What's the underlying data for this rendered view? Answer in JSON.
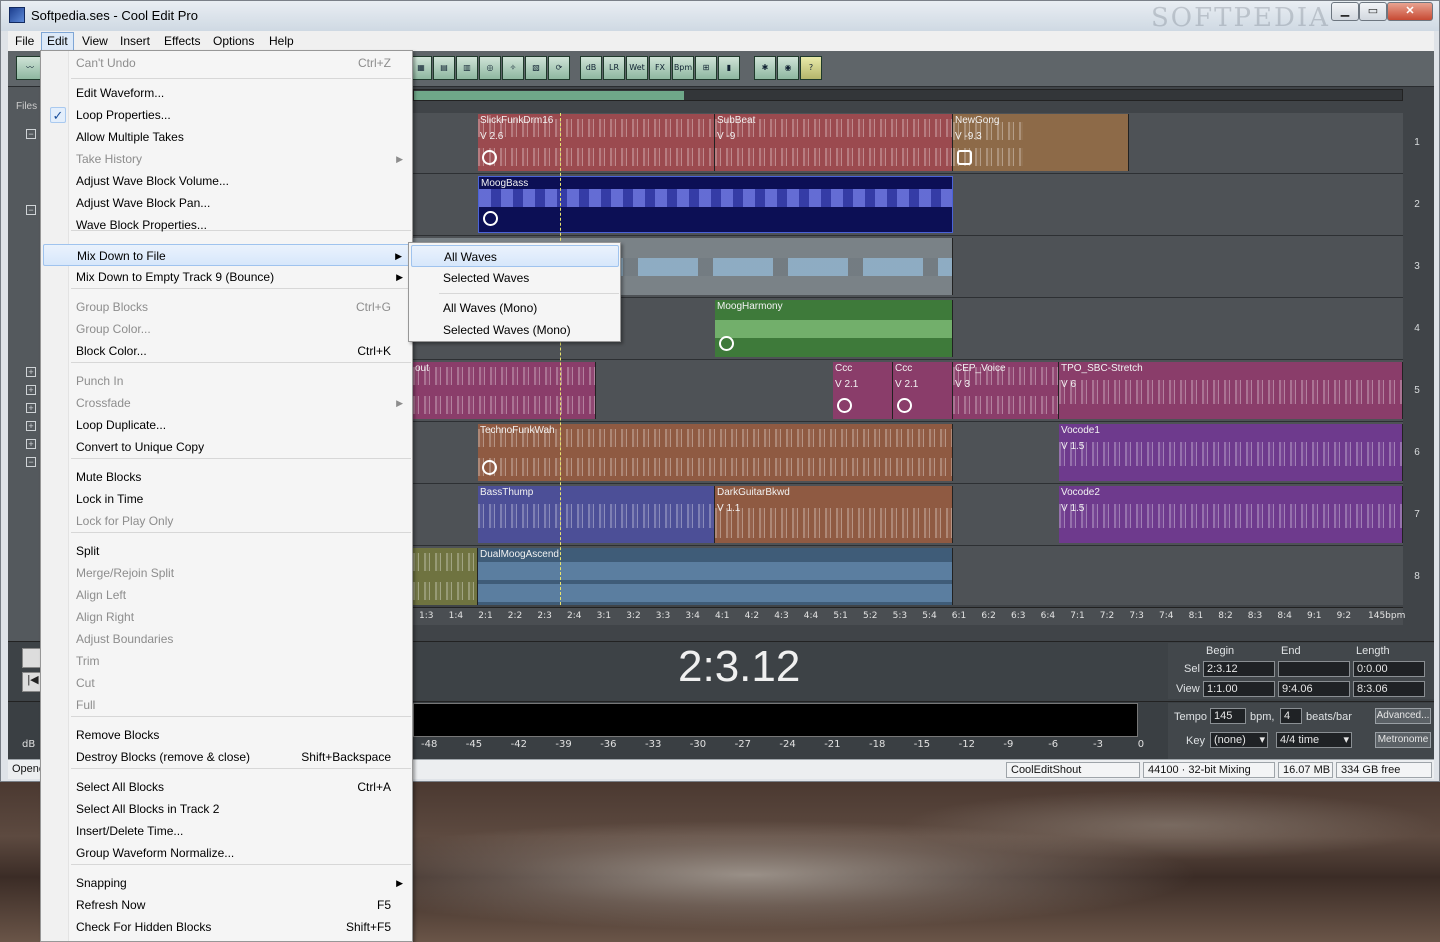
{
  "window": {
    "title": "Softpedia.ses - Cool Edit Pro",
    "watermark": "SOFTPEDIA"
  },
  "menubar": [
    "File",
    "Edit",
    "View",
    "Insert",
    "Effects",
    "Options",
    "Help"
  ],
  "edit_menu": [
    {
      "label": "Can't Undo",
      "shortcut": "Ctrl+Z",
      "disabled": true
    },
    {
      "label": "Edit Waveform...",
      "shortcut": ""
    },
    {
      "label": "Loop Properties...",
      "shortcut": "",
      "checked": true
    },
    {
      "label": "Allow Multiple Takes",
      "shortcut": ""
    },
    {
      "label": "Take History",
      "shortcut": "",
      "disabled": true,
      "submenu": true
    },
    {
      "label": "Adjust Wave Block Volume...",
      "shortcut": ""
    },
    {
      "label": "Adjust Wave Block Pan...",
      "shortcut": ""
    },
    {
      "label": "Wave Block Properties...",
      "shortcut": ""
    },
    {
      "label": "Mix Down to File",
      "shortcut": "",
      "submenu": true,
      "highlighted": true
    },
    {
      "label": "Mix Down to Empty Track 9 (Bounce)",
      "shortcut": "",
      "submenu": true
    },
    {
      "label": "Group Blocks",
      "shortcut": "Ctrl+G",
      "disabled": true
    },
    {
      "label": "Group Color...",
      "shortcut": "",
      "disabled": true
    },
    {
      "label": "Block Color...",
      "shortcut": "Ctrl+K"
    },
    {
      "label": "Punch In",
      "shortcut": "",
      "disabled": true
    },
    {
      "label": "Crossfade",
      "shortcut": "",
      "disabled": true,
      "submenu": true
    },
    {
      "label": "Loop Duplicate...",
      "shortcut": ""
    },
    {
      "label": "Convert to Unique Copy",
      "shortcut": ""
    },
    {
      "label": "Mute Blocks",
      "shortcut": ""
    },
    {
      "label": "Lock in Time",
      "shortcut": ""
    },
    {
      "label": "Lock for Play Only",
      "shortcut": "",
      "disabled": true
    },
    {
      "label": "Split",
      "shortcut": ""
    },
    {
      "label": "Merge/Rejoin Split",
      "shortcut": "",
      "disabled": true
    },
    {
      "label": "Align Left",
      "shortcut": "",
      "disabled": true
    },
    {
      "label": "Align Right",
      "shortcut": "",
      "disabled": true
    },
    {
      "label": "Adjust Boundaries",
      "shortcut": "",
      "disabled": true
    },
    {
      "label": "Trim",
      "shortcut": "",
      "disabled": true
    },
    {
      "label": "Cut",
      "shortcut": "",
      "disabled": true
    },
    {
      "label": "Full",
      "shortcut": "",
      "disabled": true
    },
    {
      "label": "Remove Blocks",
      "shortcut": ""
    },
    {
      "label": "Destroy Blocks (remove & close)",
      "shortcut": "Shift+Backspace"
    },
    {
      "label": "Select All Blocks",
      "shortcut": "Ctrl+A"
    },
    {
      "label": "Select All Blocks in Track 2",
      "shortcut": ""
    },
    {
      "label": "Insert/Delete Time...",
      "shortcut": ""
    },
    {
      "label": "Group Waveform Normalize...",
      "shortcut": ""
    },
    {
      "label": "Snapping",
      "shortcut": "",
      "submenu": true
    },
    {
      "label": "Refresh Now",
      "shortcut": "F5"
    },
    {
      "label": "Check For Hidden Blocks",
      "shortcut": "Shift+F5"
    }
  ],
  "submenu": [
    "All Waves",
    "Selected Waves",
    "All Waves (Mono)",
    "Selected Waves (Mono)"
  ],
  "tracks": [
    {
      "num": "1",
      "blocks": [
        {
          "name": "SlickFunkDrm16",
          "ver": "V 2.6",
          "color": "#9b4a4f"
        },
        {
          "name": "SubBeat",
          "ver": "V -9",
          "color": "#9b4a4f"
        },
        {
          "name": "NewGong",
          "ver": "V -9.3",
          "color": "#8d6a48"
        }
      ]
    },
    {
      "num": "2",
      "blocks": [
        {
          "name": "MoogBass",
          "ver": "",
          "color": "#0c0f55"
        }
      ]
    },
    {
      "num": "3",
      "blocks": [
        {
          "name": "",
          "ver": "",
          "color": "#7a8287"
        }
      ]
    },
    {
      "num": "4",
      "blocks": [
        {
          "name": "MoogHarmony",
          "ver": "",
          "color": "#3e7a3a"
        }
      ]
    },
    {
      "num": "5",
      "blocks": [
        {
          "name": "out",
          "ver": "",
          "color": "#8a3d6a"
        },
        {
          "name": "Ccc",
          "ver": "V 2.1",
          "color": "#8a3d6a"
        },
        {
          "name": "Ccc",
          "ver": "V 2.1",
          "color": "#8a3d6a"
        },
        {
          "name": "CEP_Voice",
          "ver": "V 3",
          "color": "#8a3d6a"
        },
        {
          "name": "TPO_SBC-Stretch",
          "ver": "V 6",
          "color": "#8a3d6a"
        }
      ]
    },
    {
      "num": "6",
      "blocks": [
        {
          "name": "TechnoFunkWah",
          "ver": "",
          "color": "#8f5a42"
        },
        {
          "name": "Vocode1",
          "ver": "V 1.5",
          "color": "#6e3a8d"
        }
      ]
    },
    {
      "num": "7",
      "blocks": [
        {
          "name": "BassThump",
          "ver": "",
          "color": "#4c4f97"
        },
        {
          "name": "DarkGuitarBkwd",
          "ver": "V 1.1",
          "color": "#8f5a42"
        },
        {
          "name": "Vocode2",
          "ver": "V 1.5",
          "color": "#6e3a8d"
        }
      ]
    },
    {
      "num": "8",
      "blocks": [
        {
          "name": "",
          "ver": "",
          "color": "#6f7340"
        },
        {
          "name": "DualMoogAscend",
          "ver": "",
          "color": "#3f5c78"
        }
      ]
    }
  ],
  "ruler": [
    "1:3",
    "1:4",
    "2:1",
    "2:2",
    "2:3",
    "2:4",
    "3:1",
    "3:2",
    "3:3",
    "3:4",
    "4:1",
    "4:2",
    "4:3",
    "4:4",
    "5:1",
    "5:2",
    "5:3",
    "5:4",
    "6:1",
    "6:2",
    "6:3",
    "6:4",
    "7:1",
    "7:2",
    "7:3",
    "7:4",
    "8:1",
    "8:2",
    "8:3",
    "8:4",
    "9:1",
    "9:2",
    "145bpm"
  ],
  "time": "2:3.12",
  "selection": {
    "headers": [
      "Begin",
      "End",
      "Length"
    ],
    "sel_label": "Sel",
    "view_label": "View",
    "sel": [
      "2:3.12",
      "",
      "0:0.00"
    ],
    "view": [
      "1:1.00",
      "9:4.06",
      "8:3.06"
    ]
  },
  "db_scale": [
    "dB",
    "-48",
    "-45",
    "-42",
    "-39",
    "-36",
    "-33",
    "-30",
    "-27",
    "-24",
    "-21",
    "-18",
    "-15",
    "-12",
    "-9",
    "-6",
    "-3",
    "0"
  ],
  "tempo": {
    "tempo_label": "Tempo",
    "tempo_value": "145",
    "bpm_label": "bpm,",
    "beats_value": "4",
    "beats_label": "beats/bar",
    "advanced": "Advanced...",
    "key_label": "Key",
    "key_value": "(none)",
    "time_sig": "4/4 time",
    "metronome": "Metronome"
  },
  "status": {
    "left": "Opene",
    "file": "CoolEditShout",
    "format": "44100 · 32-bit Mixing",
    "mem": "16.07 MB",
    "disk": "334 GB free"
  },
  "left_tab": "Files"
}
